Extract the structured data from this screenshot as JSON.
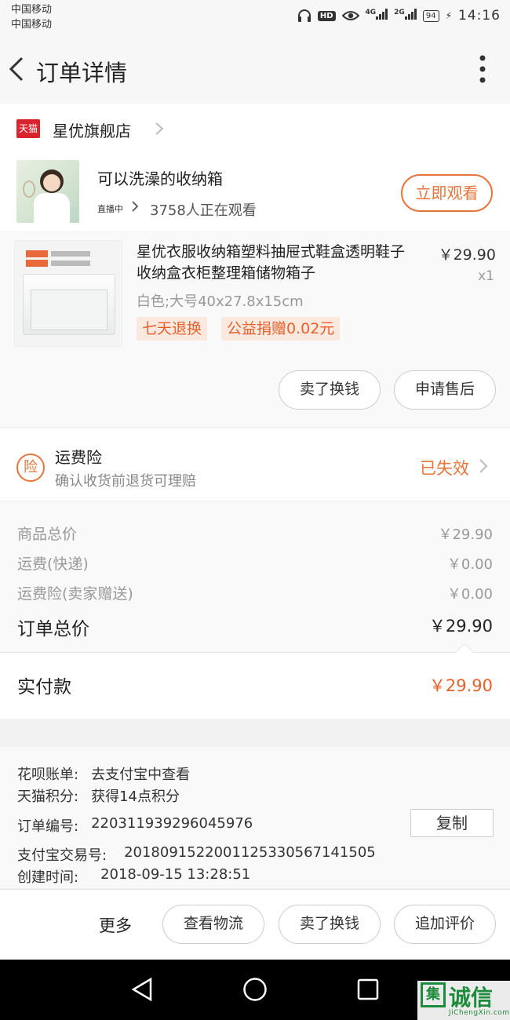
{
  "status_bar": {
    "carrier1": "中国移动",
    "carrier2": "中国移动",
    "hd": "HD",
    "net1": "4G",
    "net2": "2G",
    "battery": "94",
    "time": "14:16"
  },
  "header": {
    "title": "订单详情",
    "back_icon": "chevron-left-icon",
    "more_icon": "more-vertical-icon"
  },
  "shop": {
    "logo_text": "天猫",
    "name": "星优旗舰店"
  },
  "live": {
    "title": "可以洗澡的收纳箱",
    "tag": "直播中",
    "viewers": "3758人正在观看",
    "watch_button": "立即观看"
  },
  "product": {
    "title": "星优衣服收纳箱塑料抽屉式鞋盒透明鞋子收纳盒衣柜整理箱储物箱子",
    "price": "￥29.90",
    "qty": "x1",
    "sku": "白色;大号40x27.8x15cm",
    "tags": [
      "七天退换",
      "公益捐赠0.02元"
    ],
    "sell_button": "卖了换钱",
    "after_sale_button": "申请售后"
  },
  "insurance": {
    "icon_text": "险",
    "title": "运费险",
    "subtitle": "确认收货前退货可理赔",
    "status": "已失效"
  },
  "summary": {
    "items": [
      {
        "label": "商品总价",
        "value": "￥29.90"
      },
      {
        "label": "运费(快递)",
        "value": "￥0.00"
      },
      {
        "label": "运费险(卖家赠送)",
        "value": "￥0.00"
      }
    ],
    "total_label": "订单总价",
    "total_value": "￥29.90",
    "paid_label": "实付款",
    "paid_value": "￥29.90"
  },
  "info": {
    "huabei_key": "花呗账单:",
    "huabei_val": "去支付宝中查看",
    "points_key": "天猫积分:",
    "points_val": "获得14点积分",
    "order_no_key": "订单编号:",
    "order_no_val": "220311939296045976",
    "copy_button": "复制",
    "alipay_key": "支付宝交易号:",
    "alipay_val": "2018091522001125330567141505",
    "created_key": "创建时间:",
    "created_val": "2018-09-15 13:28:51"
  },
  "bottom_bar": {
    "more": "更多",
    "logistics_button": "查看物流",
    "sell_button": "卖了换钱",
    "review_button": "追加评价"
  },
  "watermark": {
    "logo_char": "集",
    "text": "诚信",
    "sub": "JiChengXin.com"
  }
}
